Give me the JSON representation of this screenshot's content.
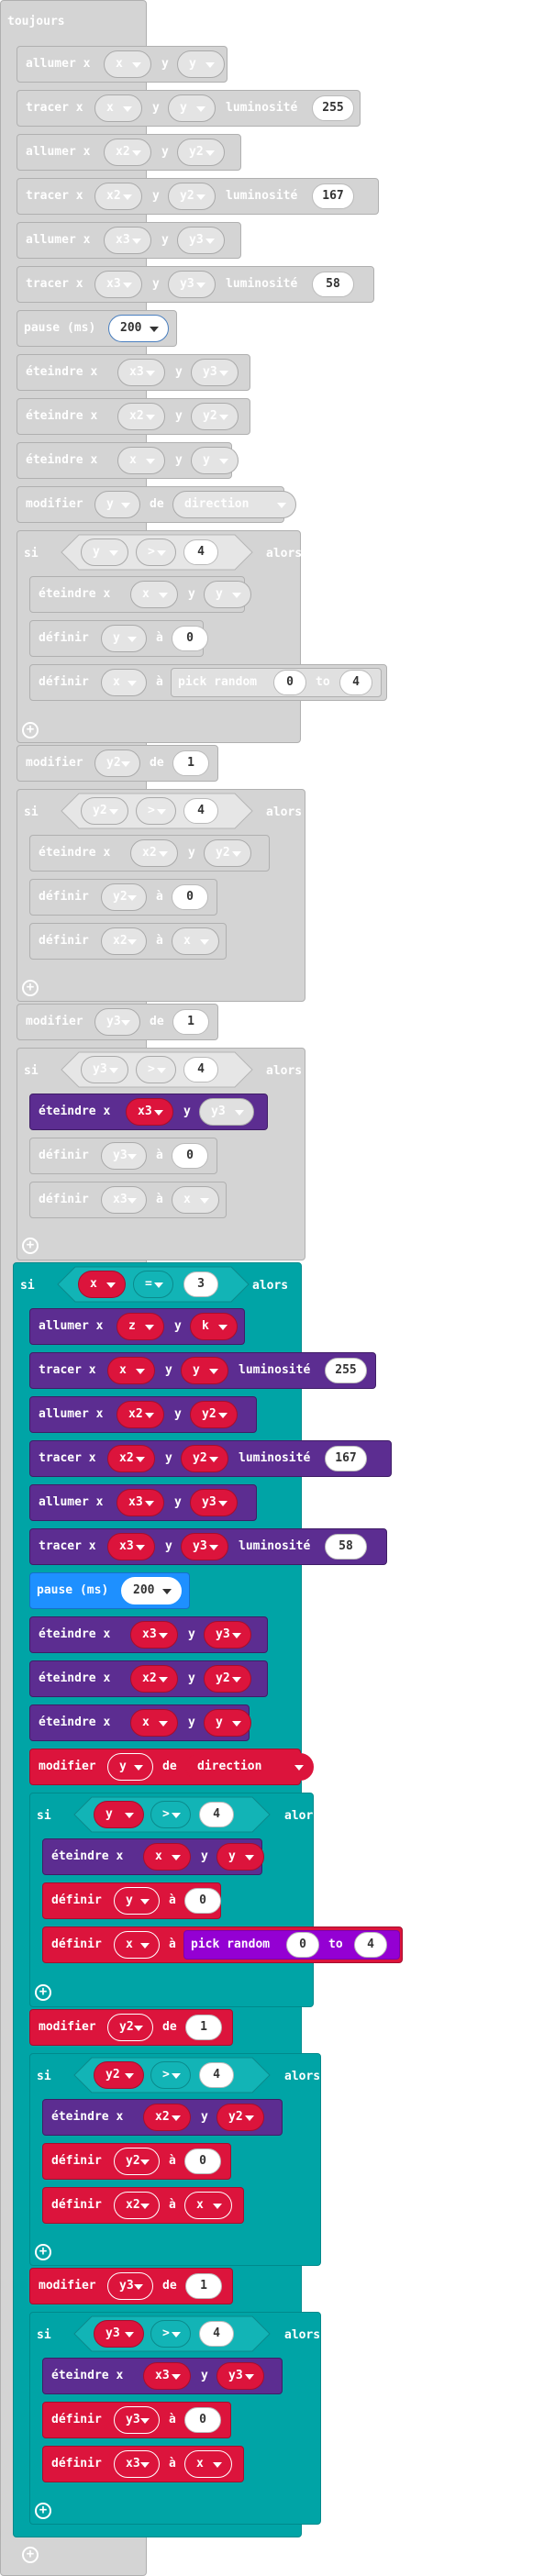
{
  "colors": {
    "disabled_fill": "#d4d4d4",
    "disabled_border": "#b0b0b0",
    "disabled_text": "#ffffff",
    "led_purple": "#5c2d91",
    "var_red": "#dc143c",
    "logic_teal": "#00a4a6",
    "basic_blue": "#1e90ff",
    "math_violet": "#9400d3"
  },
  "forever_label": "toujours",
  "words": {
    "allumer": "allumer x",
    "tracer": "tracer x",
    "eteindre": "éteindre x",
    "y": "y",
    "luminosite": "luminosité",
    "pause": "pause (ms)",
    "modifier": "modifier",
    "de": "de",
    "si": "si",
    "alors": "alors",
    "definir": "définir",
    "a": "à",
    "pick_random": "pick random",
    "to": "to",
    "plus": "+"
  },
  "vars": {
    "x": "x",
    "y": "y",
    "z": "z",
    "k": "k",
    "x2": "x2",
    "y2": "y2",
    "x3": "x3",
    "y3": "y3",
    "direction": "direction"
  },
  "ops": {
    "gt": ">",
    "eq": "="
  },
  "nums": {
    "b255": "255",
    "b167": "167",
    "b58": "58",
    "p200": "200",
    "n4": "4",
    "n0": "0",
    "n1": "1",
    "n3": "3"
  }
}
